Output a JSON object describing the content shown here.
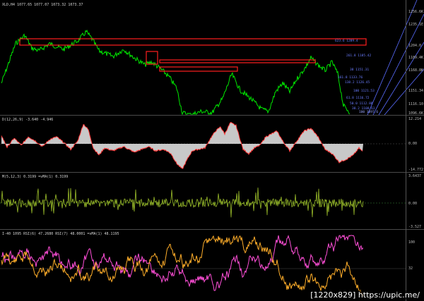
{
  "chart": {
    "symbol_line": "XLD,H4  1077.65  1077.07  1073.32  1073.37",
    "price_axis": [
      "1256.6K",
      "1235.1E",
      "1204.0",
      "1189.4K",
      "1168.8K",
      "1151.34",
      "1116.10",
      "1096.6K"
    ],
    "fib_levels": [
      "623.6 1209.4",
      "261.8 1185.42",
      "38 1151.31",
      "161.8 1133.76",
      "138.2 1126.45",
      "100 1121.53",
      "61.8 1116.72",
      "50.0 1112.88",
      "38.2 1108.61"
    ],
    "low_fib_text": "100 1097.6"
  },
  "macd_pane": {
    "label": "D(12,26,9) -3.640 -4.946",
    "axis": [
      "12.214",
      "0.00",
      "-14.772"
    ]
  },
  "osc_pane": {
    "label": "M(5,12,3) 0.3199  =vMA(1) 0.3199",
    "axis": [
      "3.6437",
      "0.00",
      "-3.527"
    ]
  },
  "rsi_pane": {
    "label": "I-40 1095  RSI(6) 47.2680  RSI(7) 48.0001  =vMA(1) 48.1195",
    "axis": [
      "100",
      "32",
      "0"
    ]
  },
  "colors": {
    "price": "#00e600",
    "zone": "#ff1f1f",
    "macd_fill": "#c8c8c8",
    "macd_line": "#ff3a3a",
    "osc": "#9bbd2a",
    "rsi_a": "#ff4fd8",
    "rsi_b": "#ffae2a",
    "channel": "#5a6cff"
  },
  "watermark": "[1220x829] https://upic.me/"
}
